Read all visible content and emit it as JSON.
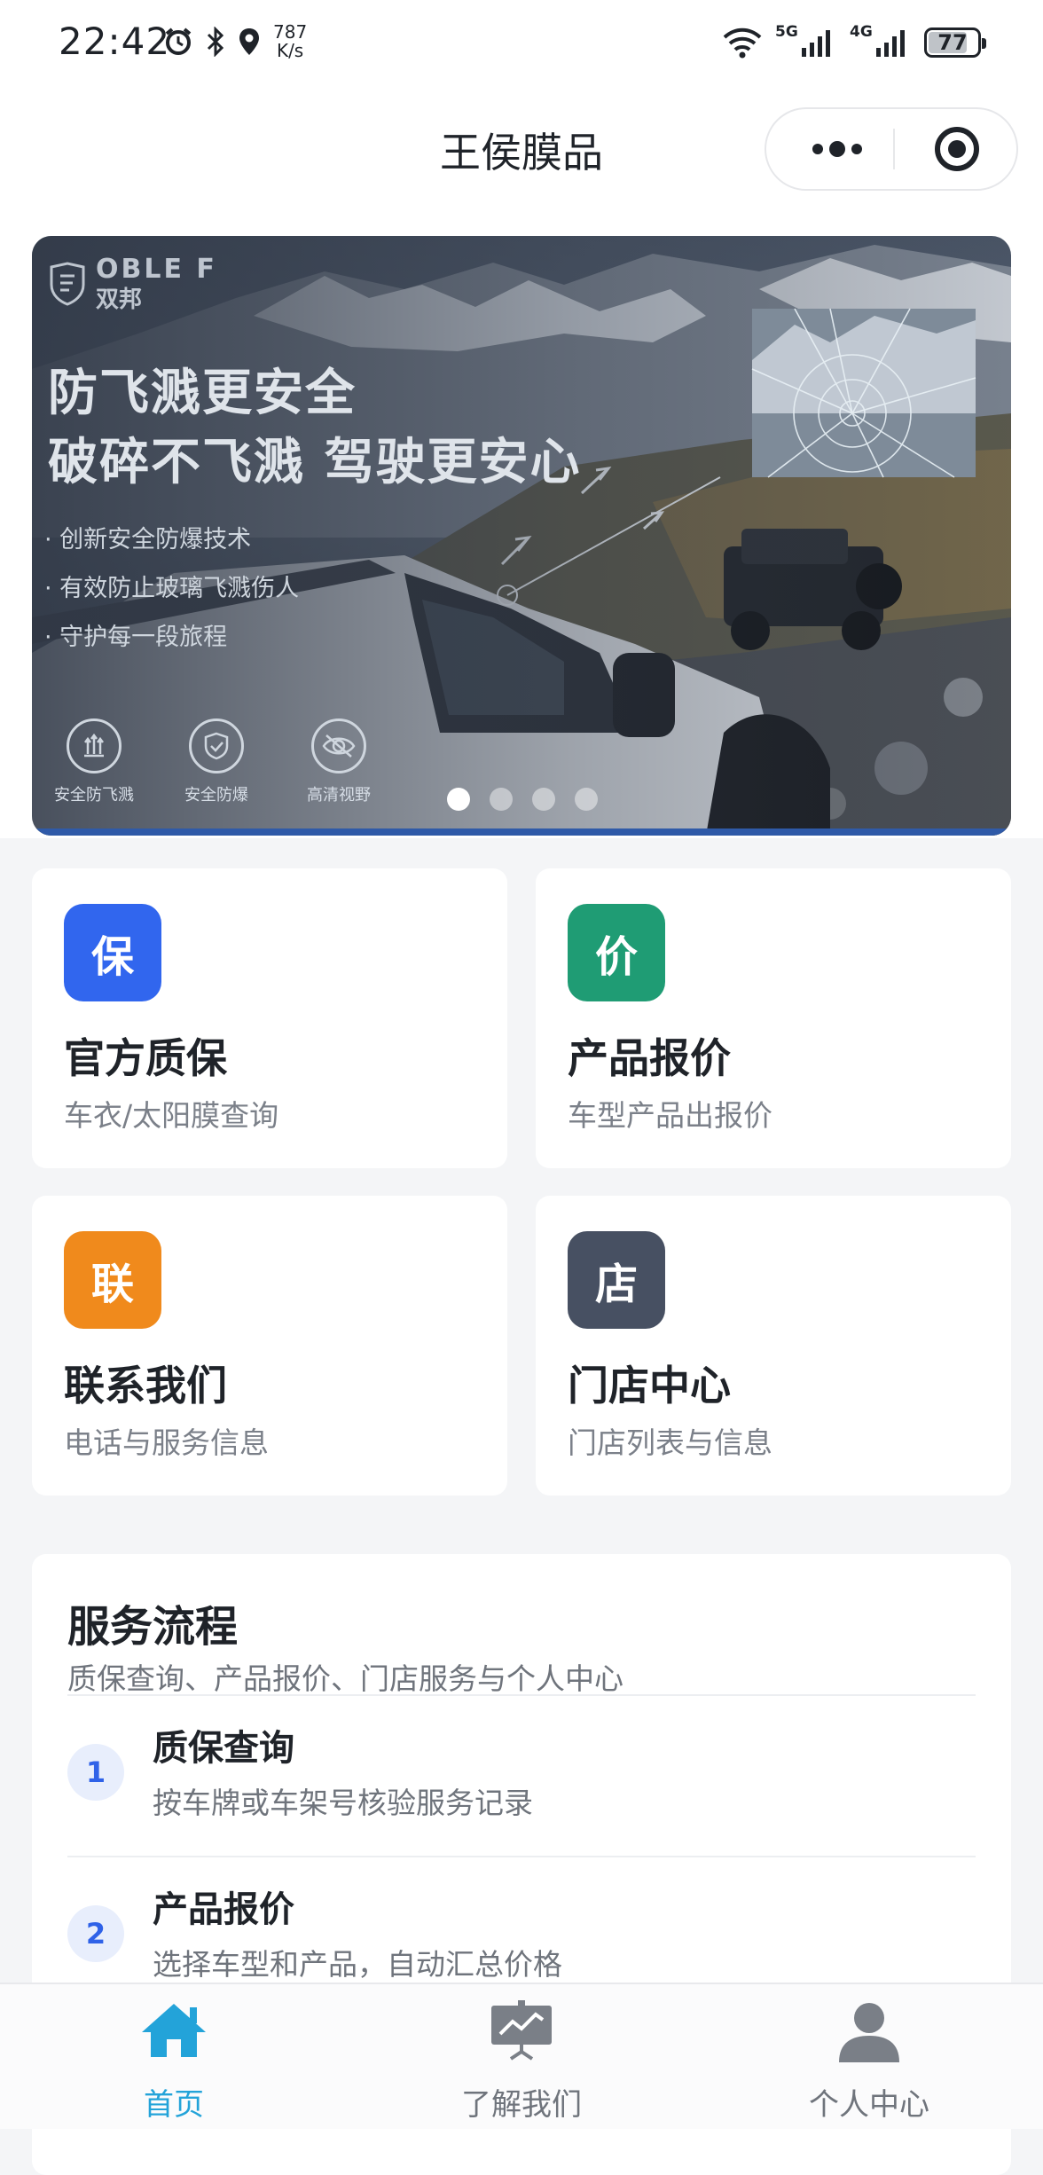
{
  "status_bar": {
    "time": "22:42",
    "speed_value": "787",
    "speed_unit": "K/s",
    "net1": "5G",
    "net2": "4G",
    "battery": "77"
  },
  "nav": {
    "title": "王侯膜品"
  },
  "banner": {
    "logo_text": "OBLE F",
    "logo_sub": "双邦",
    "headline_1": "防飞溅更安全",
    "headline_2": "破碎不飞溅 驾驶更安心",
    "bullets": [
      "· 创新安全防爆技术",
      "· 有效防止玻璃飞溅伤人",
      "· 守护每一段旅程"
    ],
    "features": [
      "安全防飞溅",
      "安全防爆",
      "高清视野"
    ],
    "page_count": 4,
    "active_page": 1
  },
  "tiles": [
    {
      "icon_char": "保",
      "title": "官方质保",
      "subtitle": "车衣/太阳膜查询",
      "color": "#3166ee"
    },
    {
      "icon_char": "价",
      "title": "产品报价",
      "subtitle": "车型产品出报价",
      "color": "#1f9c74"
    },
    {
      "icon_char": "联",
      "title": "联系我们",
      "subtitle": "电话与服务信息",
      "color": "#f08a1c"
    },
    {
      "icon_char": "店",
      "title": "门店中心",
      "subtitle": "门店列表与信息",
      "color": "#475062"
    }
  ],
  "process": {
    "title": "服务流程",
    "subtitle": "质保查询、产品报价、门店服务与个人中心",
    "steps": [
      {
        "num": "1",
        "title": "质保查询",
        "desc": "按车牌或车架号核验服务记录"
      },
      {
        "num": "2",
        "title": "产品报价",
        "desc": "选择车型和产品，自动汇总价格"
      }
    ]
  },
  "tabbar": {
    "tabs": [
      {
        "label": "首页",
        "icon": "home-icon",
        "active": true
      },
      {
        "label": "了解我们",
        "icon": "presentation-icon",
        "active": false
      },
      {
        "label": "个人中心",
        "icon": "user-icon",
        "active": false
      }
    ],
    "active_color": "#23a3d9"
  }
}
